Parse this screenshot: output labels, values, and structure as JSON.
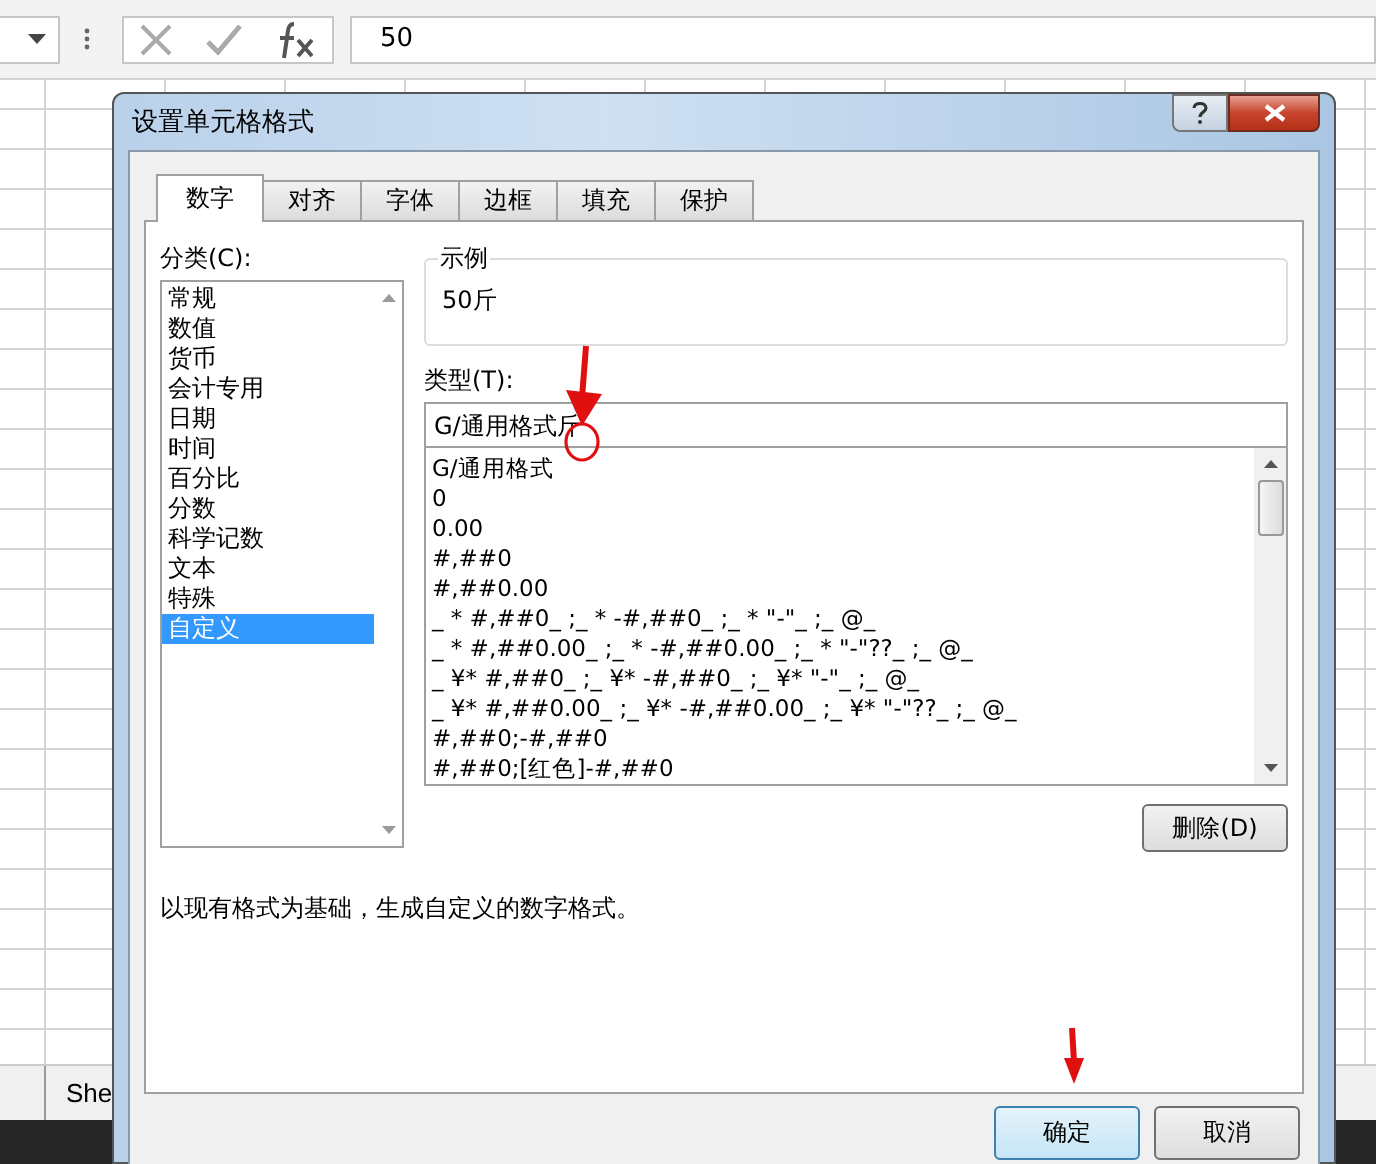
{
  "formula_bar": {
    "value": "50"
  },
  "sheet_tab": {
    "label": "She"
  },
  "dialog": {
    "title": "设置单元格格式",
    "tabs": [
      {
        "label": "数字",
        "selected": true
      },
      {
        "label": "对齐",
        "selected": false
      },
      {
        "label": "字体",
        "selected": false
      },
      {
        "label": "边框",
        "selected": false
      },
      {
        "label": "填充",
        "selected": false
      },
      {
        "label": "保护",
        "selected": false
      }
    ],
    "category_label": "分类(C):",
    "categories": [
      {
        "label": "常规",
        "selected": false
      },
      {
        "label": "数值",
        "selected": false
      },
      {
        "label": "货币",
        "selected": false
      },
      {
        "label": "会计专用",
        "selected": false
      },
      {
        "label": "日期",
        "selected": false
      },
      {
        "label": "时间",
        "selected": false
      },
      {
        "label": "百分比",
        "selected": false
      },
      {
        "label": "分数",
        "selected": false
      },
      {
        "label": "科学记数",
        "selected": false
      },
      {
        "label": "文本",
        "selected": false
      },
      {
        "label": "特殊",
        "selected": false
      },
      {
        "label": "自定义",
        "selected": true
      }
    ],
    "sample": {
      "legend": "示例",
      "value": "50斤"
    },
    "type_label": "类型(T):",
    "type_value": "G/通用格式斤",
    "formats": [
      "G/通用格式",
      "0",
      "0.00",
      "#,##0",
      "#,##0.00",
      "_ * #,##0_ ;_ * -#,##0_ ;_ * \"-\"_ ;_ @_",
      "_ * #,##0.00_ ;_ * -#,##0.00_ ;_ * \"-\"??_ ;_ @_",
      "_ ¥* #,##0_ ;_ ¥* -#,##0_ ;_ ¥* \"-\"_ ;_ @_",
      "_ ¥* #,##0.00_ ;_ ¥* -#,##0.00_ ;_ ¥* \"-\"??_ ;_ @_",
      "#,##0;-#,##0",
      "#,##0;[红色]-#,##0"
    ],
    "delete_button": "删除(D)",
    "description": "以现有格式为基础，生成自定义的数字格式。",
    "buttons": [
      "确定",
      "取消"
    ]
  }
}
